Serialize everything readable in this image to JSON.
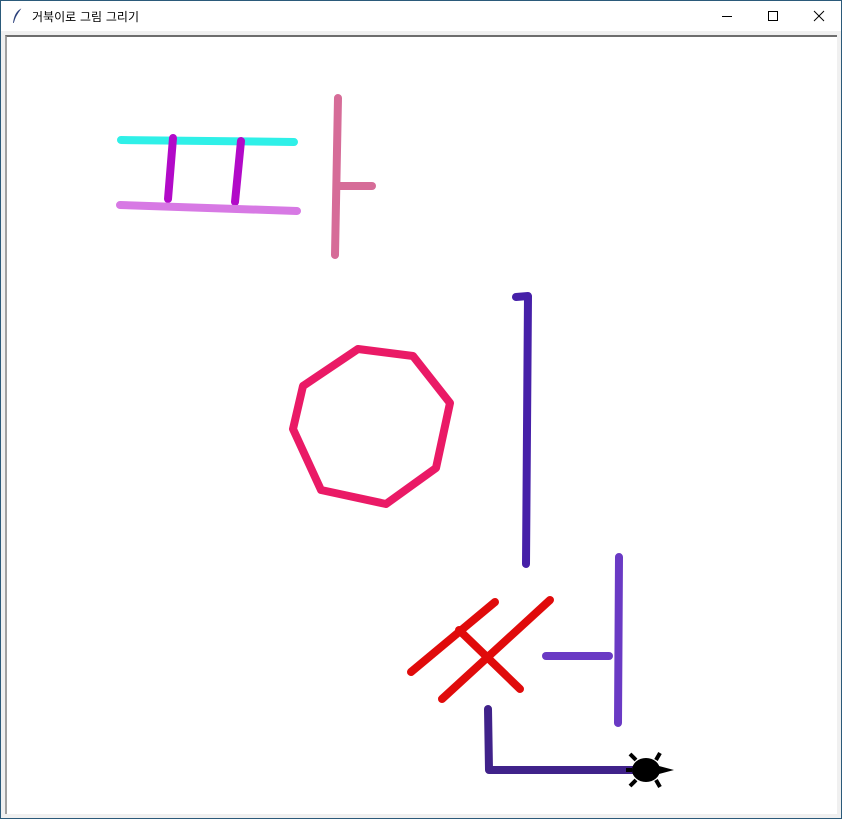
{
  "window": {
    "title": "거북이로 그림 그리기",
    "icons": {
      "app": "feather-icon",
      "minimize": "minimize-icon",
      "maximize": "maximize-icon",
      "close": "close-icon"
    }
  },
  "canvas": {
    "background": "#ffffff",
    "turtle_color": "#000000",
    "stroke_colors": {
      "cyan": "#2ff0e8",
      "purple": "#b20ac8",
      "lavender": "#d779e4",
      "pink": "#d66c98",
      "indigo": "#4620a8",
      "magenta": "#ea1a66",
      "red": "#e00b0b",
      "violet": "#6a3ac4",
      "dark_indigo": "#40228a"
    }
  }
}
